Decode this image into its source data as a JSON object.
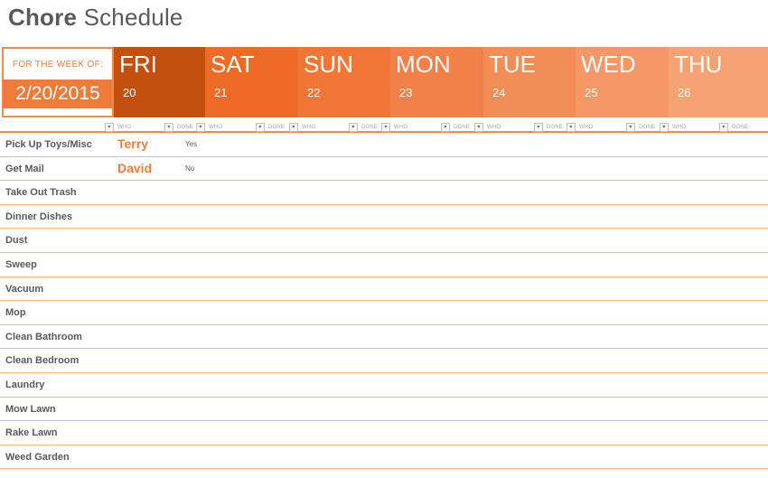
{
  "title": {
    "bold": "Chore",
    "light": "Schedule"
  },
  "week": {
    "label": "FOR THE WEEK OF:",
    "date": "2/20/2015"
  },
  "days": [
    {
      "name": "FRI",
      "num": "20",
      "color": "#c4500f"
    },
    {
      "name": "SAT",
      "num": "21",
      "color": "#ee6b27"
    },
    {
      "name": "SUN",
      "num": "22",
      "color": "#f07636"
    },
    {
      "name": "MON",
      "num": "23",
      "color": "#f18148"
    },
    {
      "name": "TUE",
      "num": "24",
      "color": "#f28d58"
    },
    {
      "name": "WED",
      "num": "25",
      "color": "#f39866"
    },
    {
      "name": "THU",
      "num": "26",
      "color": "#f4a272"
    }
  ],
  "column_headers": {
    "who": "WHO",
    "done": "DONE",
    "dropdown_icon": "▾"
  },
  "chores": [
    {
      "name": "Pick Up Toys/Misc",
      "who": "Terry",
      "done": "Yes"
    },
    {
      "name": "Get Mail",
      "who": "David",
      "done": "No"
    },
    {
      "name": "Take Out Trash",
      "who": "",
      "done": ""
    },
    {
      "name": "Dinner Dishes",
      "who": "",
      "done": ""
    },
    {
      "name": "Dust",
      "who": "",
      "done": ""
    },
    {
      "name": "Sweep",
      "who": "",
      "done": ""
    },
    {
      "name": "Vacuum",
      "who": "",
      "done": ""
    },
    {
      "name": "Mop",
      "who": "",
      "done": ""
    },
    {
      "name": "Clean Bathroom",
      "who": "",
      "done": ""
    },
    {
      "name": "Clean Bedroom",
      "who": "",
      "done": ""
    },
    {
      "name": "Laundry",
      "who": "",
      "done": ""
    },
    {
      "name": "Mow Lawn",
      "who": "",
      "done": ""
    },
    {
      "name": "Rake Lawn",
      "who": "",
      "done": ""
    },
    {
      "name": "Weed Garden",
      "who": "",
      "done": ""
    }
  ],
  "colors": {
    "accent": "#f07b39",
    "row_border": "#f4b48a"
  }
}
